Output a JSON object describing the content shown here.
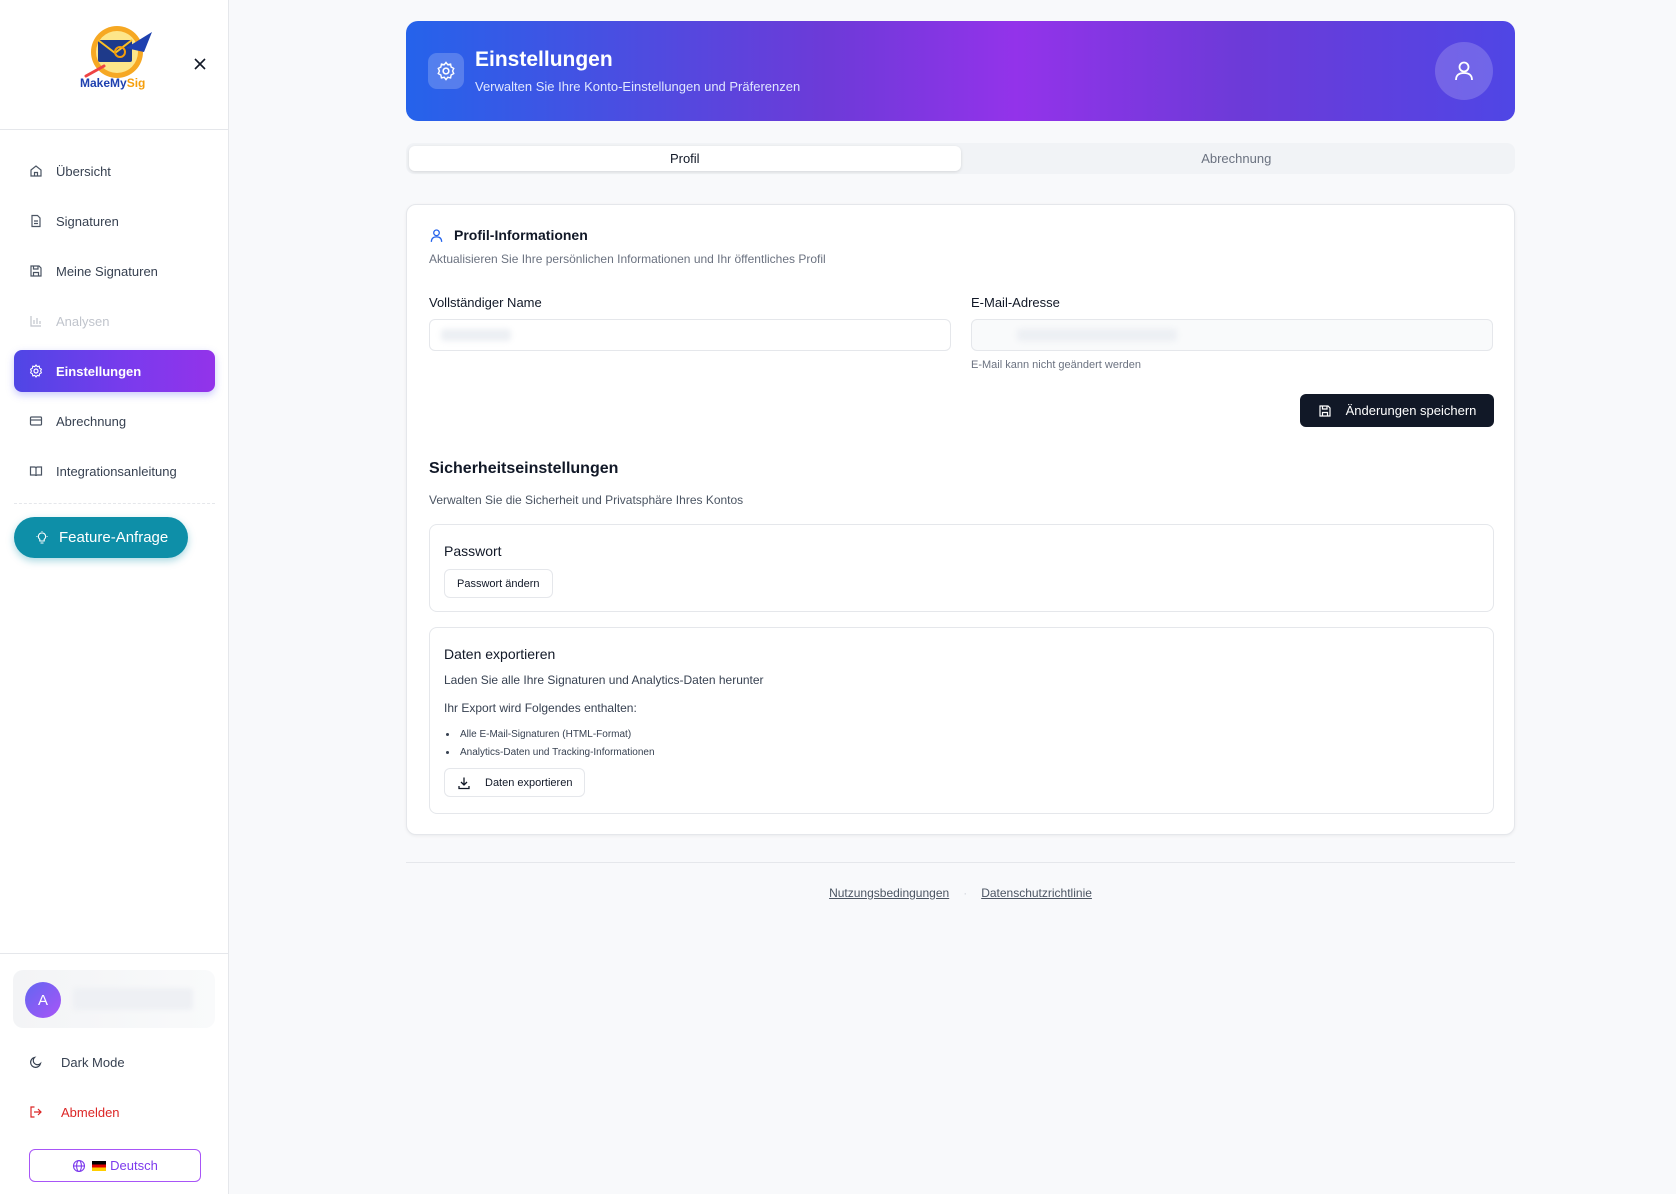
{
  "app": {
    "logo_text_main": "MakeMy",
    "logo_text_accent": "Sig"
  },
  "sidebar": {
    "items": [
      {
        "label": "Übersicht",
        "icon": "home-icon"
      },
      {
        "label": "Signaturen",
        "icon": "file-text-icon"
      },
      {
        "label": "Meine Signaturen",
        "icon": "save-icon"
      },
      {
        "label": "Analysen",
        "icon": "bar-chart-icon",
        "disabled": true
      },
      {
        "label": "Einstellungen",
        "icon": "gear-icon",
        "active": true
      },
      {
        "label": "Abrechnung",
        "icon": "credit-card-icon"
      },
      {
        "label": "Integrationsanleitung",
        "icon": "book-icon"
      }
    ],
    "feature_request_label": "Feature-Anfrage",
    "user_initial": "A",
    "dark_mode_label": "Dark Mode",
    "logout_label": "Abmelden",
    "language_label": "Deutsch"
  },
  "header": {
    "title": "Einstellungen",
    "subtitle": "Verwalten Sie Ihre Konto-Einstellungen und Präferenzen"
  },
  "tabs": [
    {
      "label": "Profil",
      "active": true
    },
    {
      "label": "Abrechnung",
      "active": false
    }
  ],
  "profile": {
    "title": "Profil-Informationen",
    "subtitle": "Aktualisieren Sie Ihre persönlichen Informationen und Ihr öffentliches Profil",
    "name_label": "Vollständiger Name",
    "name_value": "",
    "email_label": "E-Mail-Adresse",
    "email_value": "",
    "email_help": "E-Mail kann nicht geändert werden",
    "save_label": "Änderungen speichern"
  },
  "security": {
    "title": "Sicherheitseinstellungen",
    "subtitle": "Verwalten Sie die Sicherheit und Privatsphäre Ihres Kontos",
    "password_title": "Passwort",
    "password_button": "Passwort ändern",
    "export_title": "Daten exportieren",
    "export_desc": "Laden Sie alle Ihre Signaturen und Analytics-Daten herunter",
    "export_includes": "Ihr Export wird Folgendes enthalten:",
    "export_items": [
      "Alle E-Mail-Signaturen (HTML-Format)",
      "Analytics-Daten und Tracking-Informationen"
    ],
    "export_button": "Daten exportieren"
  },
  "footer": {
    "terms": "Nutzungsbedingungen",
    "separator": "·",
    "privacy": "Datenschutzrichtlinie"
  },
  "colors": {
    "accent_gradient_start": "#4f46e5",
    "accent_gradient_end": "#9333ea",
    "feature_button": "#0e8fa8",
    "logout": "#dc2626",
    "save_button": "#111827"
  }
}
